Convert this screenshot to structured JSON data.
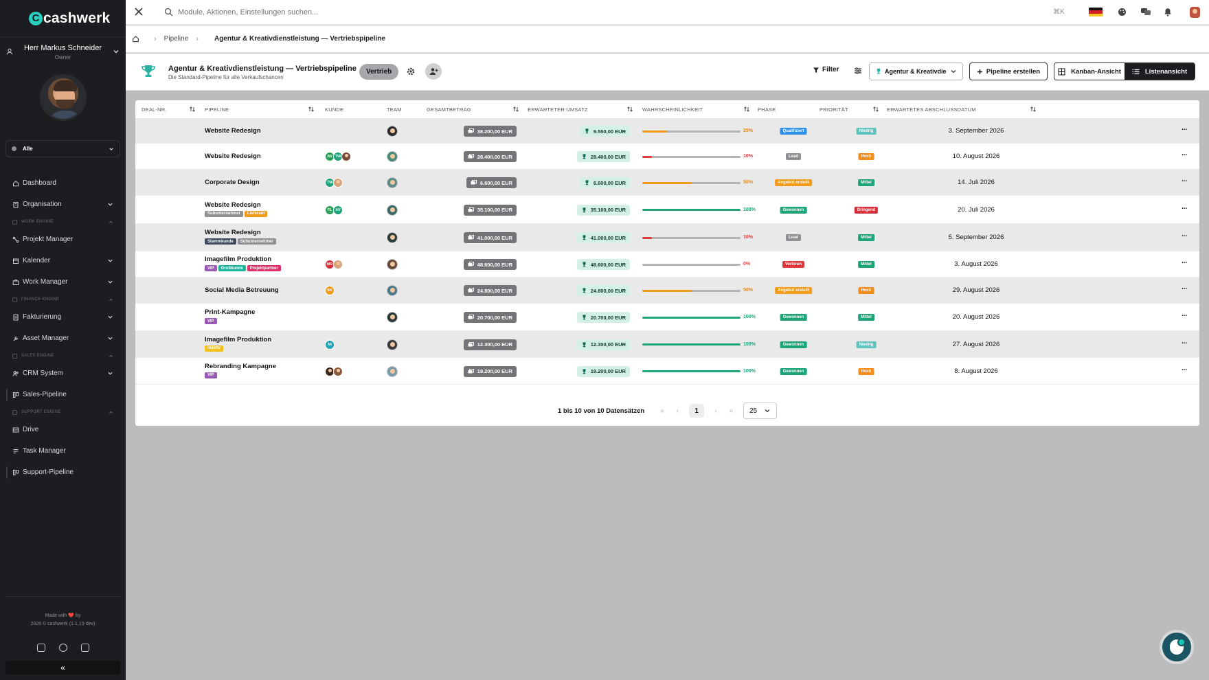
{
  "brand": {
    "name": "cashwerk",
    "mark": "C"
  },
  "user": {
    "name": "Herr Markus Schneider",
    "role": "Owner"
  },
  "scope": {
    "selected": "Alle"
  },
  "nav": {
    "dashboard": "Dashboard",
    "organisation": "Organisation",
    "section_work": "WORK ENGINE",
    "projekt_manager": "Projekt Manager",
    "kalender": "Kalender",
    "work_manager": "Work Manager",
    "section_finance": "FINANCE ENGINE",
    "fakturierung": "Fakturierung",
    "asset_manager": "Asset Manager",
    "section_sales": "SALES ENGINE",
    "crm_system": "CRM System",
    "sales_pipeline": "Sales-Pipeline",
    "section_support": "SUPPORT ENGINE",
    "drive": "Drive",
    "task_manager": "Task Manager",
    "support_pipeline": "Support-Pipeline"
  },
  "footer": {
    "made_with": "Made with ❤️ by",
    "copyright": "2026 © cashwerk (1.1.10-dev)",
    "collapse": "«"
  },
  "topbar": {
    "search_placeholder": "Module, Aktionen, Einstellungen suchen...",
    "shortcut": "⌘K"
  },
  "breadcrumb": {
    "home": "home-icon",
    "pipeline": "Pipeline",
    "current": "Agentur & Kreativdienstleistung — Vertriebspipeline"
  },
  "header": {
    "title": "Agentur & Kreativdienstleistung — Vertriebspipeline",
    "subtitle": "Die Standard-Pipeline für alle Verkaufschancen",
    "badge": "Vertrieb",
    "filter": "Filter",
    "select": "Agentur & Kreativdie",
    "create": "Pipeline erstellen",
    "kanban": "Kanban-Ansicht",
    "list": "Listenansicht"
  },
  "columns": [
    "DEAL-NR.",
    "PIPELINE",
    "KUNDE",
    "TEAM",
    "GESAMTBETRAG",
    "ERWARTETER UMSATZ",
    "WAHRSCHEINLICHKEIT",
    "PHASE",
    "PRIORITÄT",
    "ERWARTETES ABSCHLUSSDATUM"
  ],
  "colors": {
    "phase_qualifiziert": "#2f8ee6",
    "phase_lead": "#8f9094",
    "phase_angebot": "#f29b1b",
    "phase_gewonnen": "#1fa37a",
    "phase_verloren": "#e0393e",
    "prio_niedrig": "#5fc3c0",
    "prio_hoch": "#f28c1b",
    "prio_mittel": "#1fa37a",
    "prio_dringend": "#d8303a"
  },
  "rows": [
    {
      "name": "Website Redesign",
      "tags": [],
      "customers": [],
      "total": "38.200,00 EUR",
      "expected": "9.550,00 EUR",
      "probability": 25,
      "prob_label": "25%",
      "phase": "Qualifiziert",
      "phase_color": "#2f8ee6",
      "priority": "Niedrig",
      "prio_color": "#5fc3c0",
      "date": "3. September 2026"
    },
    {
      "name": "Website Redesign",
      "tags": [],
      "customers": [
        {
          "t": "AV",
          "c": "#2f9e5b"
        },
        {
          "t": "TW",
          "c": "#1fa37a"
        },
        {
          "t": "",
          "c": "#7a4a3a",
          "photo": true
        }
      ],
      "total": "28.400,00 EUR",
      "expected": "28.400,00 EUR",
      "probability": 10,
      "prob_label": "10%",
      "phase": "Lead",
      "phase_color": "#8f9094",
      "priority": "Hoch",
      "prio_color": "#f28c1b",
      "date": "10. August 2026"
    },
    {
      "name": "Corporate Design",
      "tags": [],
      "customers": [
        {
          "t": "TW",
          "c": "#1fa37a"
        },
        {
          "t": "",
          "c": "#d6a27a",
          "photo": true
        }
      ],
      "total": "6.600,00 EUR",
      "expected": "6.600,00 EUR",
      "probability": 50,
      "prob_label": "50%",
      "phase": "Angebot erstellt",
      "phase_color": "#f29b1b",
      "priority": "Mittel",
      "prio_color": "#1fa37a",
      "date": "14. Juli 2026"
    },
    {
      "name": "Website Redesign",
      "tags": [
        {
          "t": "Subunternehmer",
          "c": "#8f9094"
        },
        {
          "t": "Lieferant",
          "c": "#f29b1b"
        }
      ],
      "customers": [
        {
          "t": "FL",
          "c": "#2f9e5b"
        },
        {
          "t": "AV",
          "c": "#1fa37a"
        }
      ],
      "total": "35.100,00 EUR",
      "expected": "35.100,00 EUR",
      "probability": 100,
      "prob_label": "100%",
      "phase": "Gewonnen",
      "phase_color": "#1fa37a",
      "priority": "Dringend",
      "prio_color": "#d8303a",
      "date": "20. Juli 2026"
    },
    {
      "name": "Website Redesign",
      "tags": [
        {
          "t": "Stammkunde",
          "c": "#3d4a5c"
        },
        {
          "t": "Subunternehmer",
          "c": "#8f9094"
        }
      ],
      "customers": [],
      "total": "41.000,00 EUR",
      "expected": "41.000,00 EUR",
      "probability": 10,
      "prob_label": "10%",
      "phase": "Lead",
      "phase_color": "#8f9094",
      "priority": "Mittel",
      "prio_color": "#1fa37a",
      "date": "5. September 2026"
    },
    {
      "name": "Imagefilm Produktion",
      "tags": [
        {
          "t": "VIP",
          "c": "#9b59b6"
        },
        {
          "t": "Großkunde",
          "c": "#1fb59a"
        },
        {
          "t": "Projektpartner",
          "c": "#e0306a"
        }
      ],
      "customers": [
        {
          "t": "MR",
          "c": "#d8303a"
        },
        {
          "t": "",
          "c": "#d6a27a",
          "photo": true
        }
      ],
      "total": "48.600,00 EUR",
      "expected": "48.600,00 EUR",
      "probability": 0,
      "prob_label": "0%",
      "phase": "Verloren",
      "phase_color": "#e0393e",
      "priority": "Mittel",
      "prio_color": "#1fa37a",
      "date": "3. August 2026"
    },
    {
      "name": "Social Media Betreuung",
      "tags": [],
      "customers": [
        {
          "t": "SK",
          "c": "#f29b1b"
        }
      ],
      "total": "24.800,00 EUR",
      "expected": "24.800,00 EUR",
      "probability": 50,
      "prob_label": "50%",
      "phase": "Angebot erstellt",
      "phase_color": "#f29b1b",
      "priority": "Hoch",
      "prio_color": "#f28c1b",
      "date": "29. August 2026"
    },
    {
      "name": "Print-Kampagne",
      "tags": [
        {
          "t": "VIP",
          "c": "#9b59b6"
        }
      ],
      "customers": [],
      "total": "20.700,00 EUR",
      "expected": "20.700,00 EUR",
      "probability": 100,
      "prob_label": "100%",
      "phase": "Gewonnen",
      "phase_color": "#1fa37a",
      "priority": "Mittel",
      "prio_color": "#1fa37a",
      "date": "20. August 2026"
    },
    {
      "name": "Imagefilm Produktion",
      "tags": [
        {
          "t": "inaktiv",
          "c": "#f2c21b"
        }
      ],
      "customers": [
        {
          "t": "NI",
          "c": "#1fa3b5"
        }
      ],
      "total": "12.300,00 EUR",
      "expected": "12.300,00 EUR",
      "probability": 100,
      "prob_label": "100%",
      "phase": "Gewonnen",
      "phase_color": "#1fa37a",
      "priority": "Niedrig",
      "prio_color": "#5fc3c0",
      "date": "27. August 2026"
    },
    {
      "name": "Rebranding Kampagne",
      "tags": [
        {
          "t": "VIP",
          "c": "#9b59b6"
        }
      ],
      "customers": [
        {
          "t": "",
          "c": "#3a2a22",
          "photo": true
        },
        {
          "t": "",
          "c": "#8a5a3a",
          "photo": true
        }
      ],
      "total": "19.200,00 EUR",
      "expected": "19.200,00 EUR",
      "probability": 100,
      "prob_label": "100%",
      "phase": "Gewonnen",
      "phase_color": "#1fa37a",
      "priority": "Hoch",
      "prio_color": "#f28c1b",
      "date": "8. August 2026"
    }
  ],
  "pagination": {
    "info": "1 bis 10 von 10 Datensätzen",
    "first": "«",
    "prev": "‹",
    "page": "1",
    "next": "›",
    "last": "»",
    "size": "25"
  }
}
